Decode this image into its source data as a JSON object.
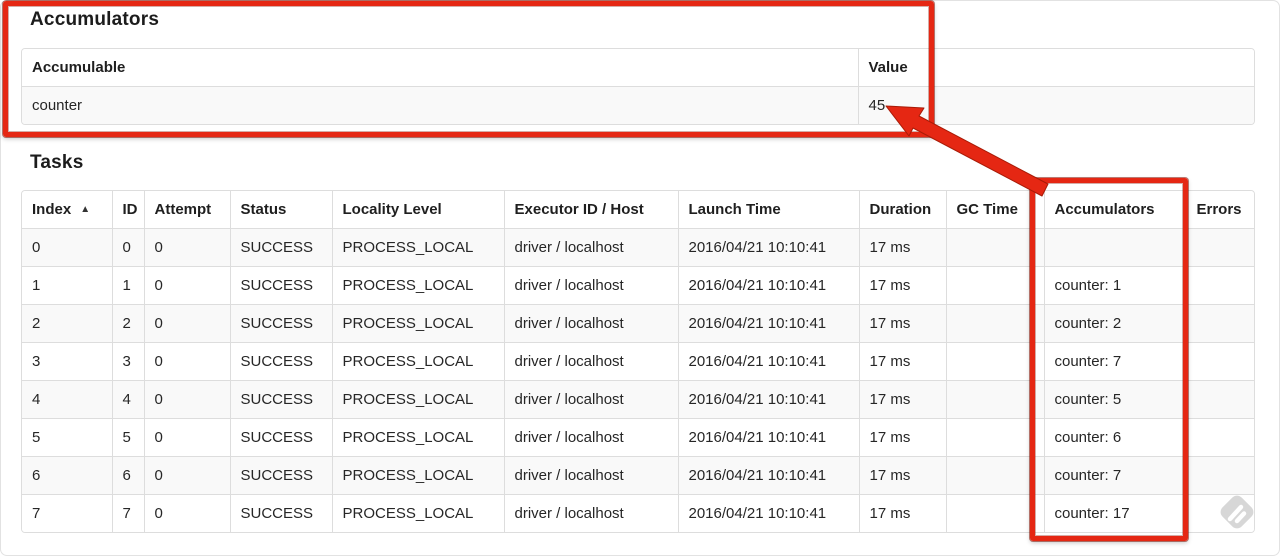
{
  "accumulators_section": {
    "title": "Accumulators",
    "table": {
      "headers": [
        "Accumulable",
        "Value"
      ],
      "rows": [
        [
          "counter",
          "45"
        ]
      ]
    }
  },
  "tasks_section": {
    "title": "Tasks",
    "table": {
      "headers": [
        "Index",
        "ID",
        "Attempt",
        "Status",
        "Locality Level",
        "Executor ID / Host",
        "Launch Time",
        "Duration",
        "GC Time",
        "Accumulators",
        "Errors"
      ],
      "sort_icon": "▲",
      "rows": [
        [
          "0",
          "0",
          "0",
          "SUCCESS",
          "PROCESS_LOCAL",
          "driver / localhost",
          "2016/04/21 10:10:41",
          "17 ms",
          "",
          "",
          ""
        ],
        [
          "1",
          "1",
          "0",
          "SUCCESS",
          "PROCESS_LOCAL",
          "driver / localhost",
          "2016/04/21 10:10:41",
          "17 ms",
          "",
          "counter: 1",
          ""
        ],
        [
          "2",
          "2",
          "0",
          "SUCCESS",
          "PROCESS_LOCAL",
          "driver / localhost",
          "2016/04/21 10:10:41",
          "17 ms",
          "",
          "counter: 2",
          ""
        ],
        [
          "3",
          "3",
          "0",
          "SUCCESS",
          "PROCESS_LOCAL",
          "driver / localhost",
          "2016/04/21 10:10:41",
          "17 ms",
          "",
          "counter: 7",
          ""
        ],
        [
          "4",
          "4",
          "0",
          "SUCCESS",
          "PROCESS_LOCAL",
          "driver / localhost",
          "2016/04/21 10:10:41",
          "17 ms",
          "",
          "counter: 5",
          ""
        ],
        [
          "5",
          "5",
          "0",
          "SUCCESS",
          "PROCESS_LOCAL",
          "driver / localhost",
          "2016/04/21 10:10:41",
          "17 ms",
          "",
          "counter: 6",
          ""
        ],
        [
          "6",
          "6",
          "0",
          "SUCCESS",
          "PROCESS_LOCAL",
          "driver / localhost",
          "2016/04/21 10:10:41",
          "17 ms",
          "",
          "counter: 7",
          ""
        ],
        [
          "7",
          "7",
          "0",
          "SUCCESS",
          "PROCESS_LOCAL",
          "driver / localhost",
          "2016/04/21 10:10:41",
          "17 ms",
          "",
          "counter: 17",
          ""
        ]
      ]
    }
  },
  "annotations": {
    "accent_color": "#e52713"
  }
}
